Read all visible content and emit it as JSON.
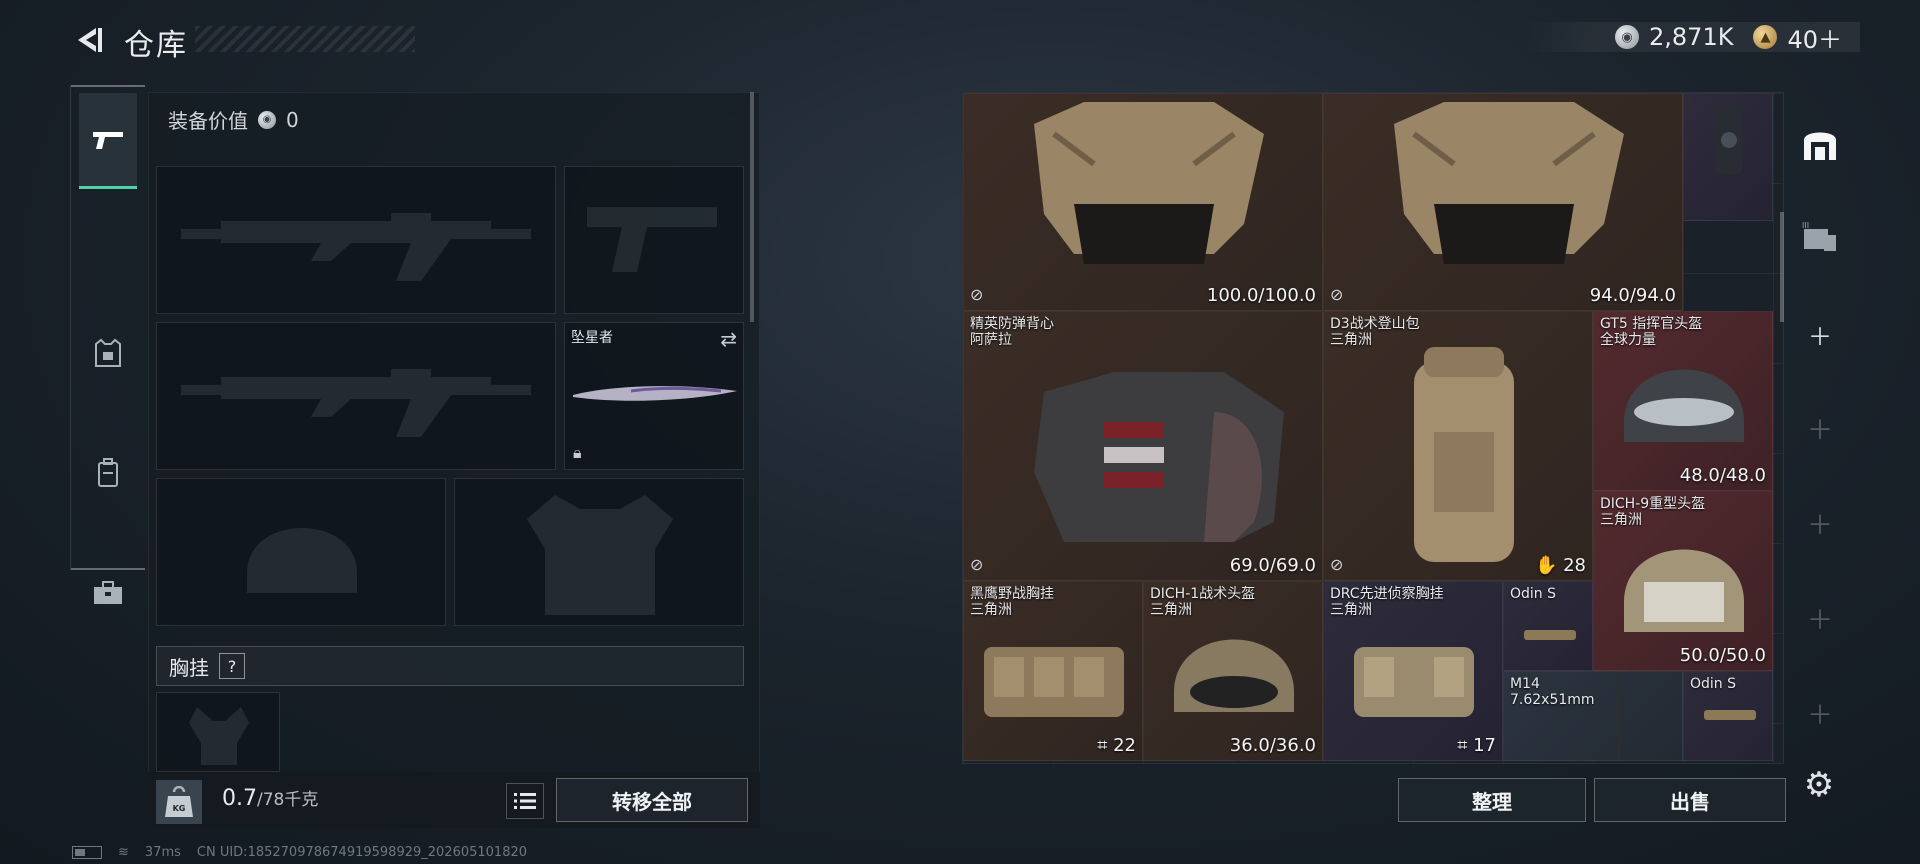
{
  "header": {
    "back_icon": "back-arrow-icon",
    "title": "仓库",
    "currency": [
      {
        "icon": "silver-coin-icon",
        "value": "2,871K",
        "color": "#c9ced3"
      },
      {
        "icon": "gold-coin-icon",
        "value": "40＋",
        "color": "#c9a25a"
      }
    ]
  },
  "nav": {
    "items": [
      {
        "name": "weapons",
        "icon": "pistol-icon",
        "active": true
      },
      {
        "name": "armor",
        "icon": "armor-vest-icon",
        "active": false
      },
      {
        "name": "backpack",
        "icon": "backpack-icon",
        "active": false
      },
      {
        "name": "toolbox",
        "icon": "toolbox-icon",
        "active": false
      }
    ]
  },
  "loadout": {
    "equip_value_label": "装备价值",
    "equip_value": "0",
    "melee_name": "坠星者",
    "rig_label": "胸挂",
    "help_label": "?",
    "weight_value": "0.7",
    "weight_max": "/78千克",
    "kg_label": "KG",
    "transfer_all": "转移全部"
  },
  "inventory": {
    "items": [
      {
        "name": "",
        "sub": "",
        "value": "100.0/100.0",
        "rarity": "brown",
        "no_repair": true
      },
      {
        "name": "",
        "sub": "",
        "value": "94.0/94.0",
        "rarity": "brown",
        "no_repair": true
      },
      {
        "name": "",
        "sub": "",
        "value": "",
        "rarity": "purple",
        "no_repair": false
      },
      {
        "name": "精英防弹背心",
        "sub": "阿萨拉",
        "value": "69.0/69.0",
        "rarity": "brown",
        "no_repair": true
      },
      {
        "name": "D3战术登山包",
        "sub": "三角洲",
        "value": "28",
        "rarity": "brown",
        "no_repair": true
      },
      {
        "name": "GT5 指挥官头盔",
        "sub": "全球力量",
        "value": "48.0/48.0",
        "rarity": "red",
        "no_repair": false
      },
      {
        "name": "DICH-9重型头盔",
        "sub": "三角洲",
        "value": "50.0/50.0",
        "rarity": "red",
        "no_repair": false
      },
      {
        "name": "黑鹰野战胸挂",
        "sub": "三角洲",
        "value": "22",
        "rarity": "brown",
        "no_repair": false
      },
      {
        "name": "DICH-1战术头盔",
        "sub": "三角洲",
        "value": "36.0/36.0",
        "rarity": "brown",
        "no_repair": false
      },
      {
        "name": "DRC先进侦察胸挂",
        "sub": "三角洲",
        "value": "17",
        "rarity": "purple",
        "no_repair": false
      },
      {
        "name": "Odin S",
        "sub": "",
        "value": "",
        "rarity": "purple",
        "no_repair": false
      },
      {
        "name": "M14",
        "sub": "7.62x51mm",
        "value": "",
        "rarity": "gray",
        "no_repair": false
      },
      {
        "name": "Odin S",
        "sub": "",
        "value": "",
        "rarity": "purple",
        "no_repair": false
      }
    ],
    "sort_button": "整理",
    "sell_button": "出售"
  },
  "right_bar": {
    "items": [
      {
        "icon": "warehouse-icon"
      },
      {
        "icon": "expand-storage-icon"
      },
      {
        "icon": "add-icon"
      }
    ],
    "settings_icon": "gear-icon"
  },
  "status": {
    "ping": "37ms",
    "uid": "CN UID:18527097867491959892​9_202605101820"
  }
}
